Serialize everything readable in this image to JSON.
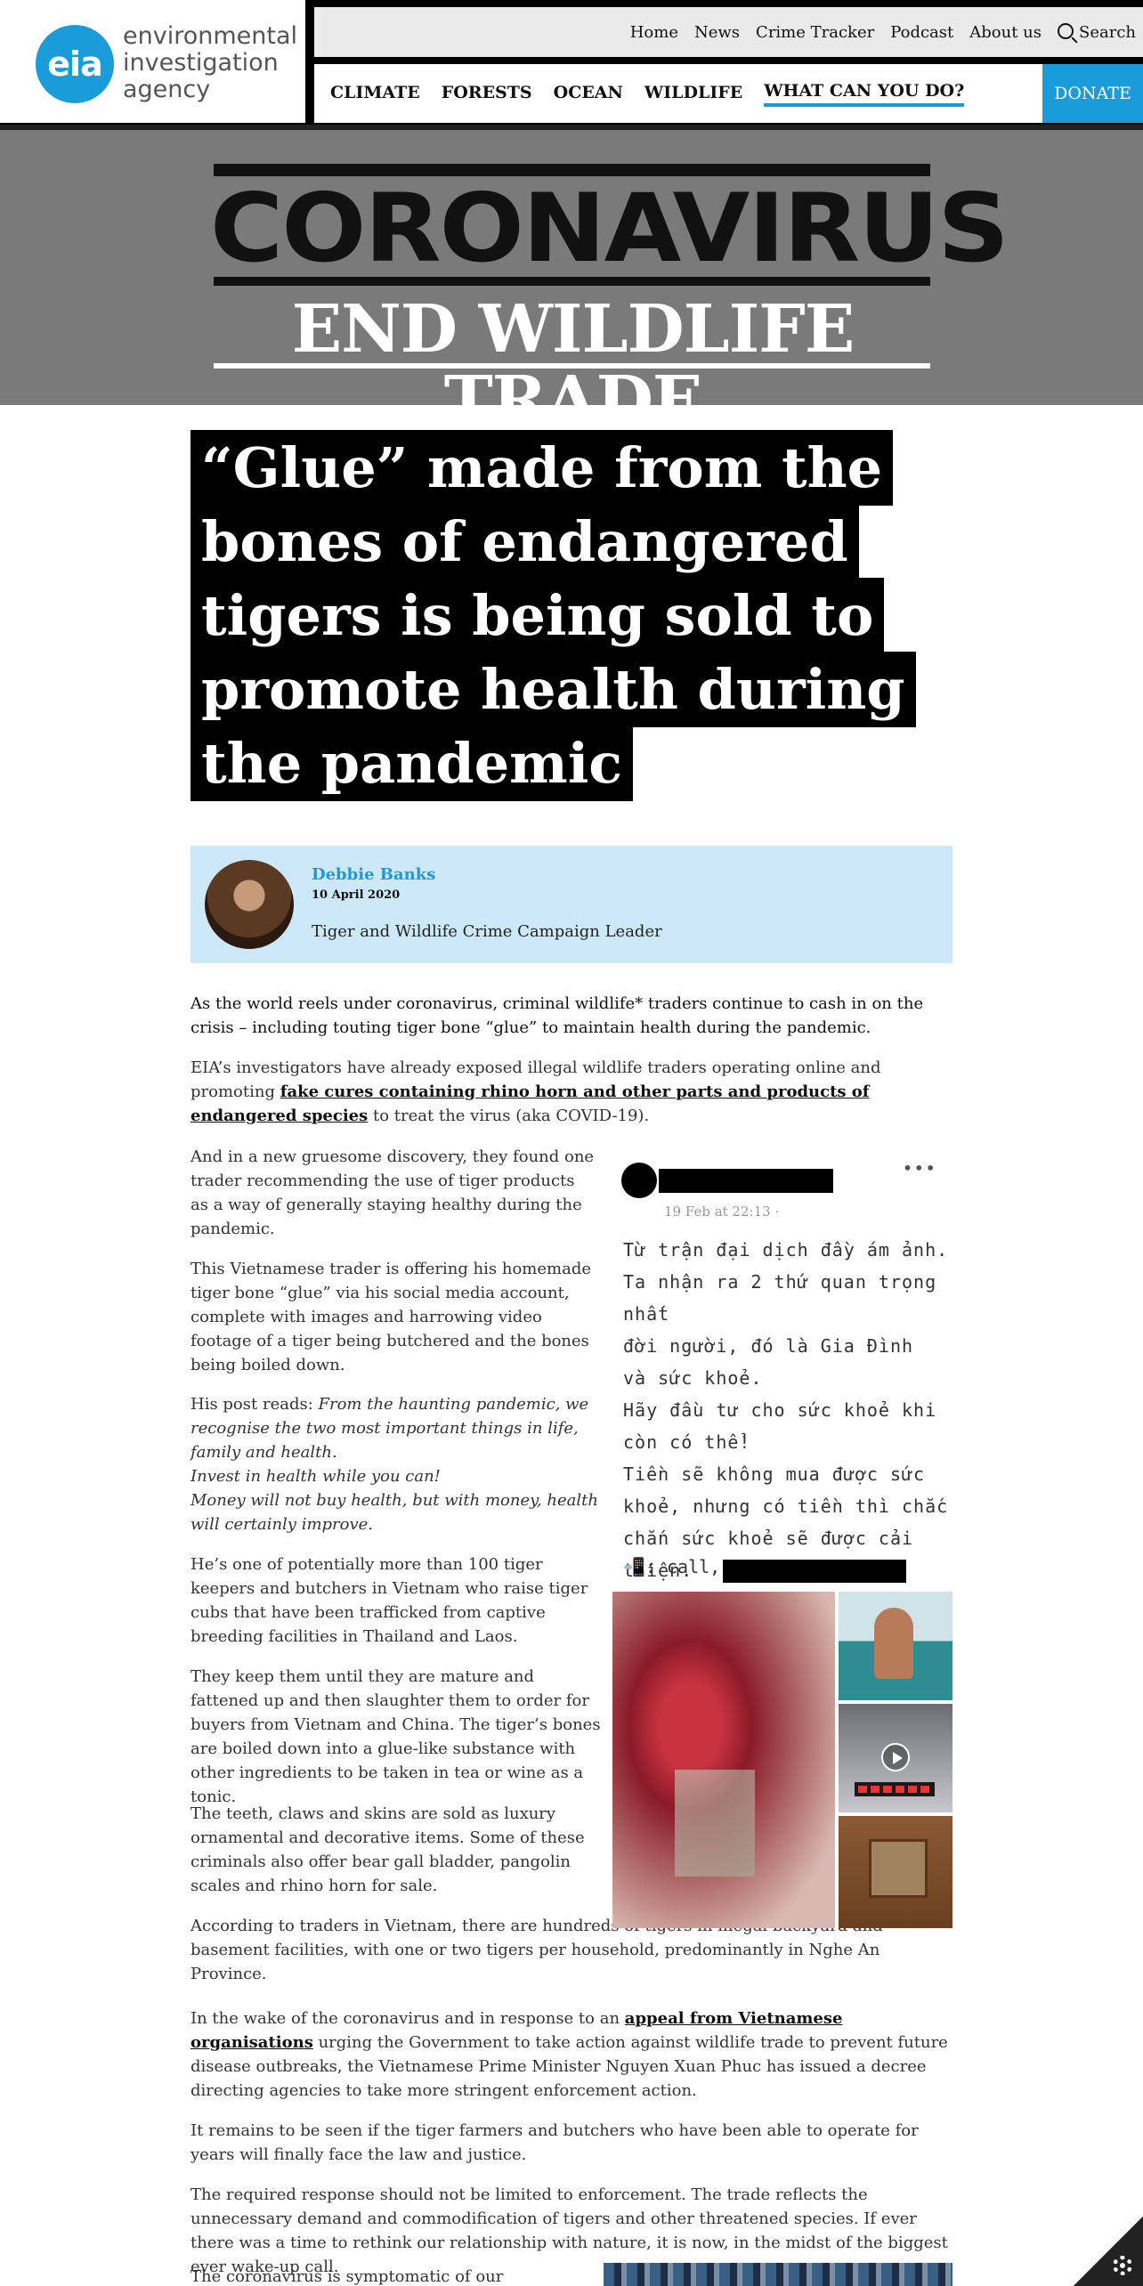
{
  "header": {
    "logo": {
      "mark": "eia",
      "lines": [
        "environmental",
        "investigation",
        "agency"
      ]
    },
    "topnav": [
      "Home",
      "News",
      "Crime Tracker",
      "Podcast",
      "About us"
    ],
    "search_label": "Search",
    "mainnav": [
      "CLIMATE",
      "FORESTS",
      "OCEAN",
      "WILDLIFE",
      "WHAT CAN YOU DO?"
    ],
    "donate_label": "DONATE"
  },
  "banner": {
    "title": "CORONAVIRUS",
    "subtitle": "END WILDLIFE TRADE"
  },
  "article": {
    "title": "“Glue” made from the bones of endangered tigers is being sold to promote health during the pandemic",
    "author": {
      "name": "Debbie Banks",
      "date": "10 April 2020",
      "role": "Tiger and Wildlife Crime Campaign Leader"
    },
    "lead": "As the world reels under coronavirus, criminal wildlife* traders continue to cash in on the crisis – including touting tiger bone “glue” to maintain health during the pandemic.",
    "p1_before": "EIA’s investigators have already exposed illegal wildlife traders operating online and promoting ",
    "p1_link": "fake cures containing rhino horn and other parts and products of endangered species",
    "p1_after": " to treat the virus (aka COVID-19).",
    "p2": "And in a new gruesome discovery, they found one trader recommending the use of tiger products as a way of generally staying healthy during the pandemic.",
    "p3": "This Vietnamese trader is offering his homemade tiger bone “glue” via his social media account, complete with images and harrowing video footage of a tiger being butchered and the bones being boiled down.",
    "p4_intro": "His post reads: ",
    "p4_quote1": "From the haunting pandemic, we recognise the two most important things in life, family and health.",
    "p4_quote2": "Invest in health while you can!",
    "p4_quote3": "Money will not buy health, but with money, health will certainly improve.",
    "p5": "He’s one of potentially more than 100 tiger keepers and butchers in Vietnam who raise tiger cubs that have been trafficked from captive breeding facilities in Thailand and Laos.",
    "p6": "They keep them until they are mature and fattened up and then slaughter them to order for buyers from Vietnam and China. The tiger’s bones are boiled down into a glue-like substance with other ingredients to be taken in tea or wine as a tonic.",
    "p7": "The teeth, claws and skins are sold as luxury ornamental and decorative items. Some of these criminals also offer bear gall bladder, pangolin scales and rhino horn for sale.",
    "p8": "According to traders in Vietnam, there are hundreds of tigers in illegal backyard and basement facilities, with one or two tigers per household, predominantly in Nghe An Province.",
    "p9_before": "In the wake of the coronavirus and in response to an ",
    "p9_link": "appeal from Vietnamese organisations",
    "p9_after": " urging the Government to take action against wildlife trade to prevent future disease outbreaks, the Vietnamese Prime Minister Nguyen Xuan Phuc has issued a decree directing agencies to take more stringent enforcement action.",
    "p10": "It remains to be seen if the tiger farmers and butchers who have been able to operate for years will finally face the law and justice.",
    "p11": "The required response should not be limited to enforcement. The trade reflects the unnecessary demand and commodification of tigers and other threatened species. If ever there was a time to rethink our relationship with nature, it is now, in the midst of the biggest ever wake-up call.",
    "p12": "The coronavirus is symptomatic of our biodiversity"
  },
  "post": {
    "date": "19 Feb at 22:13 ·",
    "text_lines": [
      "Từ trận đại dịch đầy ám ảnh.",
      "Ta nhận ra 2 thứ quan trọng nhất",
      "đời người, đó là Gia Đình",
      "và sức khoẻ.",
      "Hãy đầu tư cho sức khoẻ khi",
      "còn có thể!",
      "Tiền sẽ không mua được sức",
      "khoẻ, nhưng có tiền thì chắc",
      "chắn sức khoẻ sẽ được cải",
      "thiện."
    ],
    "call_label": "📲: call,",
    "more_label": "•••"
  },
  "colors": {
    "brand_blue": "#1a9cd8",
    "author_bg": "#cde9f7",
    "banner_bg": "#7a7a7a"
  }
}
